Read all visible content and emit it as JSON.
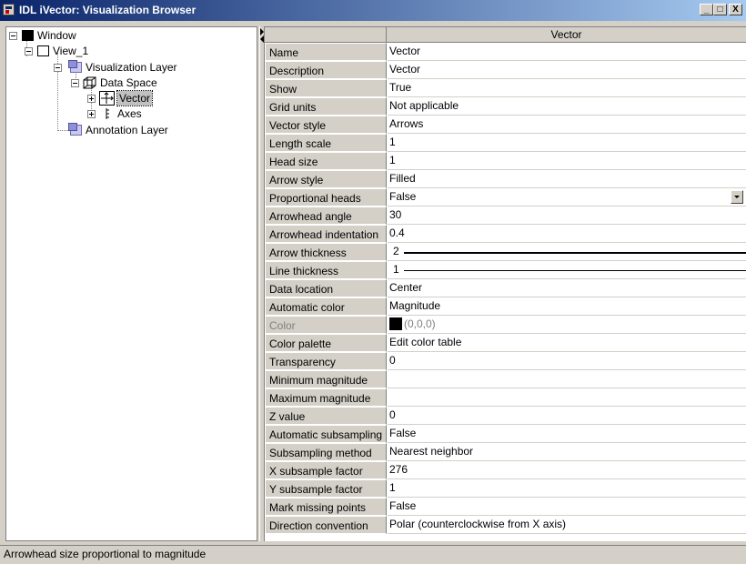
{
  "window": {
    "title": "IDL iVector: Visualization Browser"
  },
  "title_buttons": {
    "minimize": "_",
    "maximize": "□",
    "close": "X"
  },
  "tree": {
    "window": "Window",
    "view": "View_1",
    "vis_layer": "Visualization Layer",
    "data_space": "Data Space",
    "vector": "Vector",
    "axes": "Axes",
    "annotation_layer": "Annotation Layer"
  },
  "grid": {
    "column_header": "Vector",
    "properties": [
      {
        "name": "Name",
        "value": "Vector"
      },
      {
        "name": "Description",
        "value": "Vector"
      },
      {
        "name": "Show",
        "value": "True"
      },
      {
        "name": "Grid units",
        "value": "Not applicable"
      },
      {
        "name": "Vector style",
        "value": "Arrows"
      },
      {
        "name": "Length scale",
        "value": "1"
      },
      {
        "name": "Head size",
        "value": "1"
      },
      {
        "name": "Arrow style",
        "value": "Filled"
      },
      {
        "name": "Proportional heads",
        "value": "False"
      },
      {
        "name": "Arrowhead angle",
        "value": "30"
      },
      {
        "name": "Arrowhead indentation",
        "value": "0.4"
      },
      {
        "name": "Arrow thickness",
        "value": "2"
      },
      {
        "name": "Line thickness",
        "value": "1"
      },
      {
        "name": "Data location",
        "value": "Center"
      },
      {
        "name": "Automatic color",
        "value": "Magnitude"
      },
      {
        "name": "Color",
        "value": "(0,0,0)"
      },
      {
        "name": "Color palette",
        "value": "Edit color table"
      },
      {
        "name": "Transparency",
        "value": "0"
      },
      {
        "name": "Minimum magnitude",
        "value": ""
      },
      {
        "name": "Maximum magnitude",
        "value": ""
      },
      {
        "name": "Z value",
        "value": "0"
      },
      {
        "name": "Automatic subsampling",
        "value": "False"
      },
      {
        "name": "Subsampling method",
        "value": "Nearest neighbor"
      },
      {
        "name": "X subsample factor",
        "value": "276"
      },
      {
        "name": "Y subsample factor",
        "value": "1"
      },
      {
        "name": "Mark missing points",
        "value": "False"
      },
      {
        "name": "Direction convention",
        "value": "Polar (counterclockwise from X axis)"
      }
    ]
  },
  "status": {
    "text": "Arrowhead size proportional to magnitude"
  },
  "colors": {
    "titlebar_start": "#0a246a",
    "titlebar_end": "#a6caf0",
    "face": "#d4d0c8",
    "color_swatch": "#000000"
  }
}
